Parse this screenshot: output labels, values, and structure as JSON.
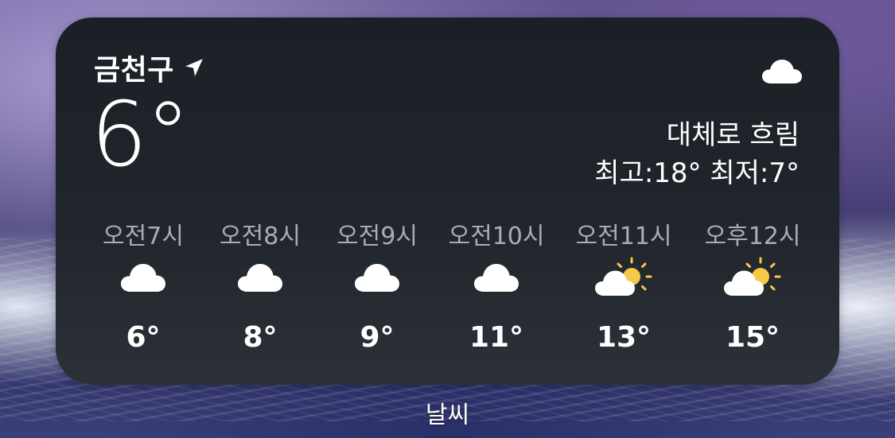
{
  "widget": {
    "location": "금천구",
    "location_icon": "location-arrow-icon",
    "current_temp": "6°",
    "condition_icon": "cloud-icon",
    "condition": "대체로 흐림",
    "hilo": "최고:18° 최저:7°"
  },
  "hourly": [
    {
      "time": "오전7시",
      "icon": "cloud-icon",
      "temp": "6°"
    },
    {
      "time": "오전8시",
      "icon": "cloud-icon",
      "temp": "8°"
    },
    {
      "time": "오전9시",
      "icon": "cloud-icon",
      "temp": "9°"
    },
    {
      "time": "오전10시",
      "icon": "cloud-icon",
      "temp": "11°"
    },
    {
      "time": "오전11시",
      "icon": "partly-sunny-icon",
      "temp": "13°"
    },
    {
      "time": "오후12시",
      "icon": "partly-sunny-icon",
      "temp": "15°"
    }
  ],
  "app_label": "날씨",
  "colors": {
    "widget_bg": "#1b2026",
    "sun": "#f7c948",
    "cloud": "#ffffff",
    "label_dim": "rgba(255,255,255,0.62)"
  }
}
